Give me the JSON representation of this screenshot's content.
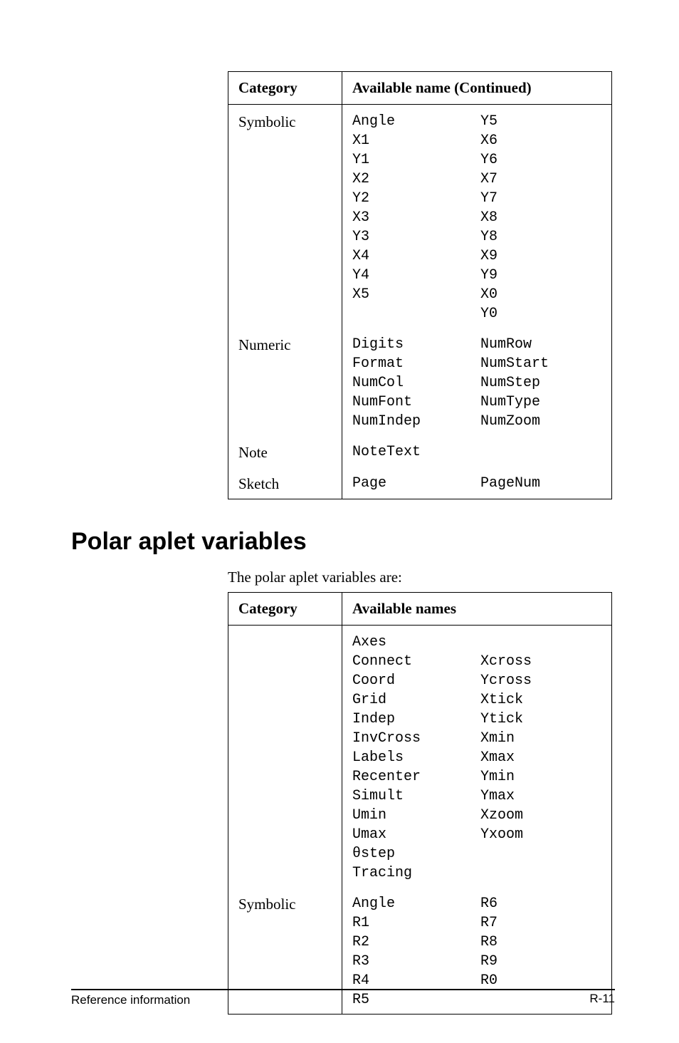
{
  "table1": {
    "header_category": "Category",
    "header_names": "Available name  (Continued)",
    "rows": [
      {
        "category": "Symbolic",
        "col1": [
          "Angle",
          "X1",
          "Y1",
          "X2",
          "Y2",
          "X3",
          "Y3",
          "X4",
          "Y4",
          "X5"
        ],
        "col2": [
          "Y5",
          "X6",
          "Y6",
          "X7",
          "Y7",
          "X8",
          "Y8",
          "X9",
          "Y9",
          "X0",
          "Y0"
        ]
      },
      {
        "category": "Numeric",
        "col1": [
          "Digits",
          "Format",
          "NumCol",
          "NumFont",
          "NumIndep"
        ],
        "col2": [
          "NumRow",
          "NumStart",
          "NumStep",
          "NumType",
          "NumZoom"
        ]
      },
      {
        "category": "Note",
        "col1": [
          "NoteText"
        ],
        "col2": []
      },
      {
        "category": "Sketch",
        "col1": [
          "Page"
        ],
        "col2": [
          "PageNum"
        ]
      }
    ]
  },
  "section_heading": "Polar aplet variables",
  "intro_text": "The polar aplet variables are:",
  "table2": {
    "header_category": "Category",
    "header_names": "Available names",
    "rows": [
      {
        "category": "",
        "col1": [
          "Axes",
          "Connect",
          "Coord",
          "Grid",
          "Indep",
          "InvCross",
          "Labels",
          "Recenter",
          "Simult",
          "Umin",
          "Umax",
          "θstep",
          "Tracing"
        ],
        "col2": [
          "",
          "Xcross",
          "Ycross",
          "Xtick",
          "Ytick",
          "Xmin",
          "Xmax",
          "Ymin",
          "Ymax",
          "Xzoom",
          "Yxoom"
        ]
      },
      {
        "category": "Symbolic",
        "col1": [
          "Angle",
          "R1",
          "R2",
          "R3",
          "R4",
          "R5"
        ],
        "col2": [
          "R6",
          "R7",
          "R8",
          "R9",
          "R0"
        ]
      }
    ]
  },
  "footer": {
    "left": "Reference information",
    "right": "R-11"
  }
}
